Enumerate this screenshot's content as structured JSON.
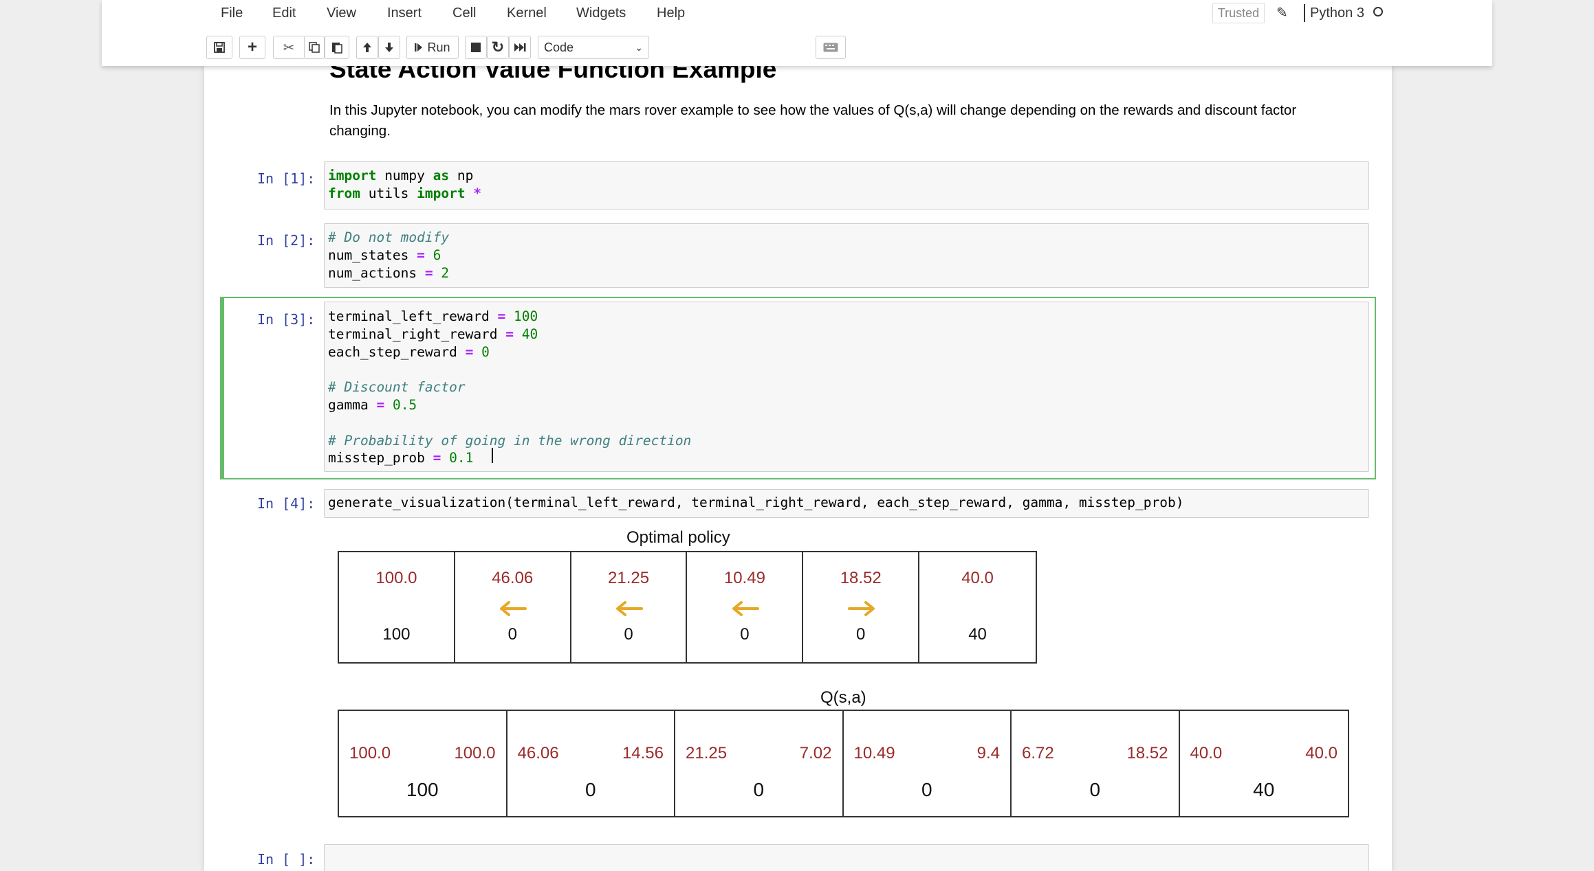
{
  "menu": [
    "File",
    "Edit",
    "View",
    "Insert",
    "Cell",
    "Kernel",
    "Widgets",
    "Help"
  ],
  "toolbar": {
    "run_label": "Run",
    "cell_type": "Code"
  },
  "status": {
    "trusted": "Trusted",
    "kernel": "Python 3"
  },
  "notebook": {
    "title": "State Action Value Function Example",
    "intro_line1": "In this Jupyter notebook, you can modify the mars rover example to see how the values of Q(s,a) will change depending on the rewards and discount factor",
    "intro_line2": "changing."
  },
  "cells": [
    {
      "prompt": "In [1]:"
    },
    {
      "prompt": "In [2]:"
    },
    {
      "prompt": "In [3]:"
    },
    {
      "prompt": "In [4]:",
      "code": "generate_visualization(terminal_left_reward, terminal_right_reward, each_step_reward, gamma, misstep_prob)"
    },
    {
      "prompt": "In [ ]:"
    }
  ],
  "policy": {
    "title": "Optimal policy",
    "values": [
      "100.0",
      "46.06",
      "21.25",
      "10.49",
      "18.52",
      "40.0"
    ],
    "rewards": [
      "100",
      "0",
      "0",
      "0",
      "0",
      "40"
    ],
    "arrows": [
      "none",
      "left",
      "left",
      "left",
      "right",
      "none"
    ]
  },
  "q": {
    "title": "Q(s,a)",
    "left": [
      "100.0",
      "46.06",
      "21.25",
      "10.49",
      "6.72",
      "40.0"
    ],
    "right": [
      "100.0",
      "14.56",
      "7.02",
      "9.4",
      "18.52",
      "40.0"
    ],
    "rewards": [
      "100",
      "0",
      "0",
      "0",
      "0",
      "40"
    ]
  },
  "colors": {
    "value": "#9c2a2a",
    "arrow": "#e6a825",
    "selected_border": "#66bb6a",
    "prompt": "#303f9f"
  }
}
